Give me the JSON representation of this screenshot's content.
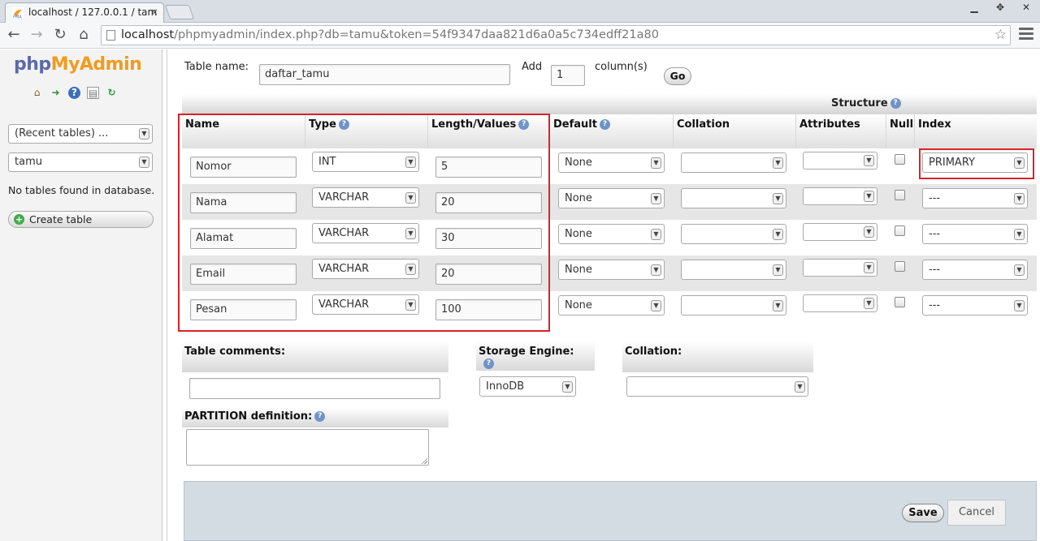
{
  "browser": {
    "tab_title": "localhost / 127.0.0.1 / tam",
    "tab_close": "×",
    "url_host": "localhost",
    "url_path": "/phpmyadmin/index.php?db=tamu&token=54f9347daa821d6a0a5c734edff21a80",
    "window_buttons": [
      "▁",
      "✥",
      "✕"
    ],
    "nav": {
      "back": "←",
      "forward": "→",
      "reload": "↻",
      "home": "⌂",
      "star": "☆"
    }
  },
  "sidebar": {
    "logo_php": "php",
    "logo_myadmin": "MyAdmin",
    "recent_tables": "(Recent tables) ...",
    "database": "tamu",
    "no_tables": "No tables found in database.",
    "create_table": "Create table"
  },
  "form": {
    "table_name_label": "Table name:",
    "table_name": "daftar_tamu",
    "add_label": "Add",
    "add_count": "1",
    "columns_label": "column(s)",
    "go": "Go",
    "structure_label": "Structure",
    "headers": {
      "name": "Name",
      "type": "Type",
      "length": "Length/Values",
      "default": "Default",
      "collation": "Collation",
      "attributes": "Attributes",
      "null": "Null",
      "index": "Index"
    },
    "columns": [
      {
        "name": "Nomor",
        "type": "INT",
        "length": "5",
        "default": "None",
        "collation": "",
        "attributes": "",
        "null": false,
        "index": "PRIMARY"
      },
      {
        "name": "Nama",
        "type": "VARCHAR",
        "length": "20",
        "default": "None",
        "collation": "",
        "attributes": "",
        "null": false,
        "index": "---"
      },
      {
        "name": "Alamat",
        "type": "VARCHAR",
        "length": "30",
        "default": "None",
        "collation": "",
        "attributes": "",
        "null": false,
        "index": "---"
      },
      {
        "name": "Email",
        "type": "VARCHAR",
        "length": "20",
        "default": "None",
        "collation": "",
        "attributes": "",
        "null": false,
        "index": "---"
      },
      {
        "name": "Pesan",
        "type": "VARCHAR",
        "length": "100",
        "default": "None",
        "collation": "",
        "attributes": "",
        "null": false,
        "index": "---"
      }
    ],
    "table_comments_label": "Table comments:",
    "storage_engine_label": "Storage Engine:",
    "storage_engine": "InnoDB",
    "collation_label": "Collation:",
    "partition_label": "PARTITION definition:",
    "save": "Save",
    "cancel": "Cancel"
  },
  "colors": {
    "highlight_border": "#d8232a",
    "logo_php": "#5c6aa8",
    "logo_myadmin": "#f29b1d",
    "footer_bg": "#d3dbe3"
  }
}
